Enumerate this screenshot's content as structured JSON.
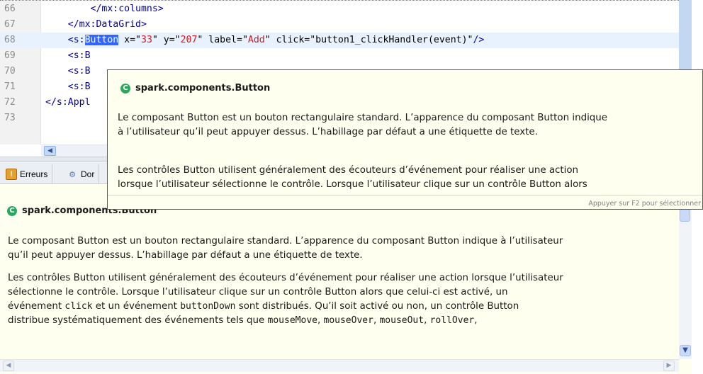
{
  "editor": {
    "lines": [
      {
        "num": "66",
        "indent": "        ",
        "parts": [
          {
            "t": "</mx:columns>",
            "c": "tag"
          }
        ]
      },
      {
        "num": "67",
        "indent": "    ",
        "parts": [
          {
            "t": "</mx:DataGrid>",
            "c": "tag"
          }
        ]
      },
      {
        "num": "68",
        "indent": "    ",
        "current": true,
        "parts": [
          {
            "t": "<s:",
            "c": "tag"
          },
          {
            "t": "Button",
            "c": "sel"
          },
          {
            "t": " x=\"",
            "c": ""
          },
          {
            "t": "33",
            "c": "val"
          },
          {
            "t": "\" y=\"",
            "c": ""
          },
          {
            "t": "207",
            "c": "val"
          },
          {
            "t": "\" label=\"",
            "c": ""
          },
          {
            "t": "Add",
            "c": "val"
          },
          {
            "t": "\" click=\"button1_clickHandler(event)\"",
            "c": ""
          },
          {
            "t": "/>",
            "c": "tag"
          }
        ]
      },
      {
        "num": "69",
        "indent": "    ",
        "parts": [
          {
            "t": "<s:B",
            "c": "tag"
          }
        ]
      },
      {
        "num": "70",
        "indent": "    ",
        "parts": [
          {
            "t": "<s:B",
            "c": "tag"
          }
        ]
      },
      {
        "num": "71",
        "indent": "    ",
        "parts": [
          {
            "t": "<s:B",
            "c": "tag"
          }
        ]
      },
      {
        "num": "72",
        "indent": "",
        "parts": [
          {
            "t": "</s:Appl",
            "c": "tag"
          }
        ]
      },
      {
        "num": "73",
        "indent": "",
        "parts": []
      }
    ]
  },
  "tabs": {
    "errors_label": "Erreurs",
    "second_label": "Dor"
  },
  "doc": {
    "title": "spark.components.Button",
    "para1": "Le composant Button est un bouton rectangulaire standard. L’apparence du composant Button indique à l’utilisateur\nqu’il peut appuyer dessus. L’habillage par défaut a une étiquette de texte.",
    "para2_a": "Les contrôles Button utilisent généralement des écouteurs d’événement pour réaliser une action lorsque l’utilisateur\nsélectionne le contrôle. Lorsque l’utilisateur clique sur un contrôle Button alors que celui-ci est activé, un\névénement ",
    "code_click": "click",
    "para2_b": " et un événement ",
    "code_buttonDown": "buttonDown",
    "para2_c": " sont distribués. Qu’il soit activé ou non, un contrôle Button\ndistribue systématiquement des événements tels que ",
    "code_mouseMove": "mouseMove",
    "sep1": ", ",
    "code_mouseOver": "mouseOver",
    "sep2": ", ",
    "code_mouseOut": "mouseOut",
    "sep3": ", ",
    "code_rollOver": "rollOver",
    "sep4": ","
  },
  "tooltip": {
    "title": "spark.components.Button",
    "para1": "Le composant Button est un bouton rectangulaire standard. L’apparence du composant Button indique\nà l’utilisateur qu’il peut appuyer dessus. L’habillage par défaut a une étiquette de texte.",
    "para2": "Les contrôles Button utilisent généralement des écouteurs d’événement pour réaliser une action\nlorsque l’utilisateur sélectionne le contrôle. Lorsque l’utilisateur clique sur un contrôle Button alors",
    "footer": "Appuyer sur F2 pour sélectionner"
  },
  "icons": {
    "class_icon": "class-c-icon",
    "errors_icon": "errors-icon",
    "gear_icon": "gear-icon"
  },
  "colors": {
    "tag": "#0000a8",
    "value": "#d2191c",
    "selection": "#3366ff",
    "tooltip_bg": "#fffff0"
  }
}
